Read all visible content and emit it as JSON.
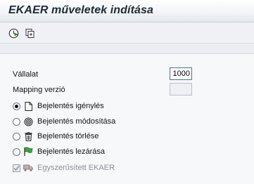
{
  "window": {
    "title": "EKAER műveletek indítása"
  },
  "toolbar": {
    "buttons": [
      {
        "name": "execute",
        "icon": "execute-clock-icon"
      },
      {
        "name": "variants",
        "icon": "get-variant-icon"
      }
    ]
  },
  "form": {
    "company_label": "Vállalat",
    "company_value": "1000",
    "mapping_label": "Mapping verzió",
    "mapping_value": ""
  },
  "options": [
    {
      "label": "Bejelentés igénylés",
      "icon": "document-icon",
      "selected": true
    },
    {
      "label": "Bejelentés módosítása",
      "icon": "spiral-modify-icon",
      "selected": false
    },
    {
      "label": "Bejelentés törlése",
      "icon": "trash-icon",
      "selected": false
    },
    {
      "label": "Bejelentés lezárása",
      "icon": "green-flag-icon",
      "selected": false
    }
  ],
  "simplified": {
    "label": "Egyszerűsített EKAER",
    "icon": "truck-icon",
    "checked": true,
    "enabled": false
  }
}
